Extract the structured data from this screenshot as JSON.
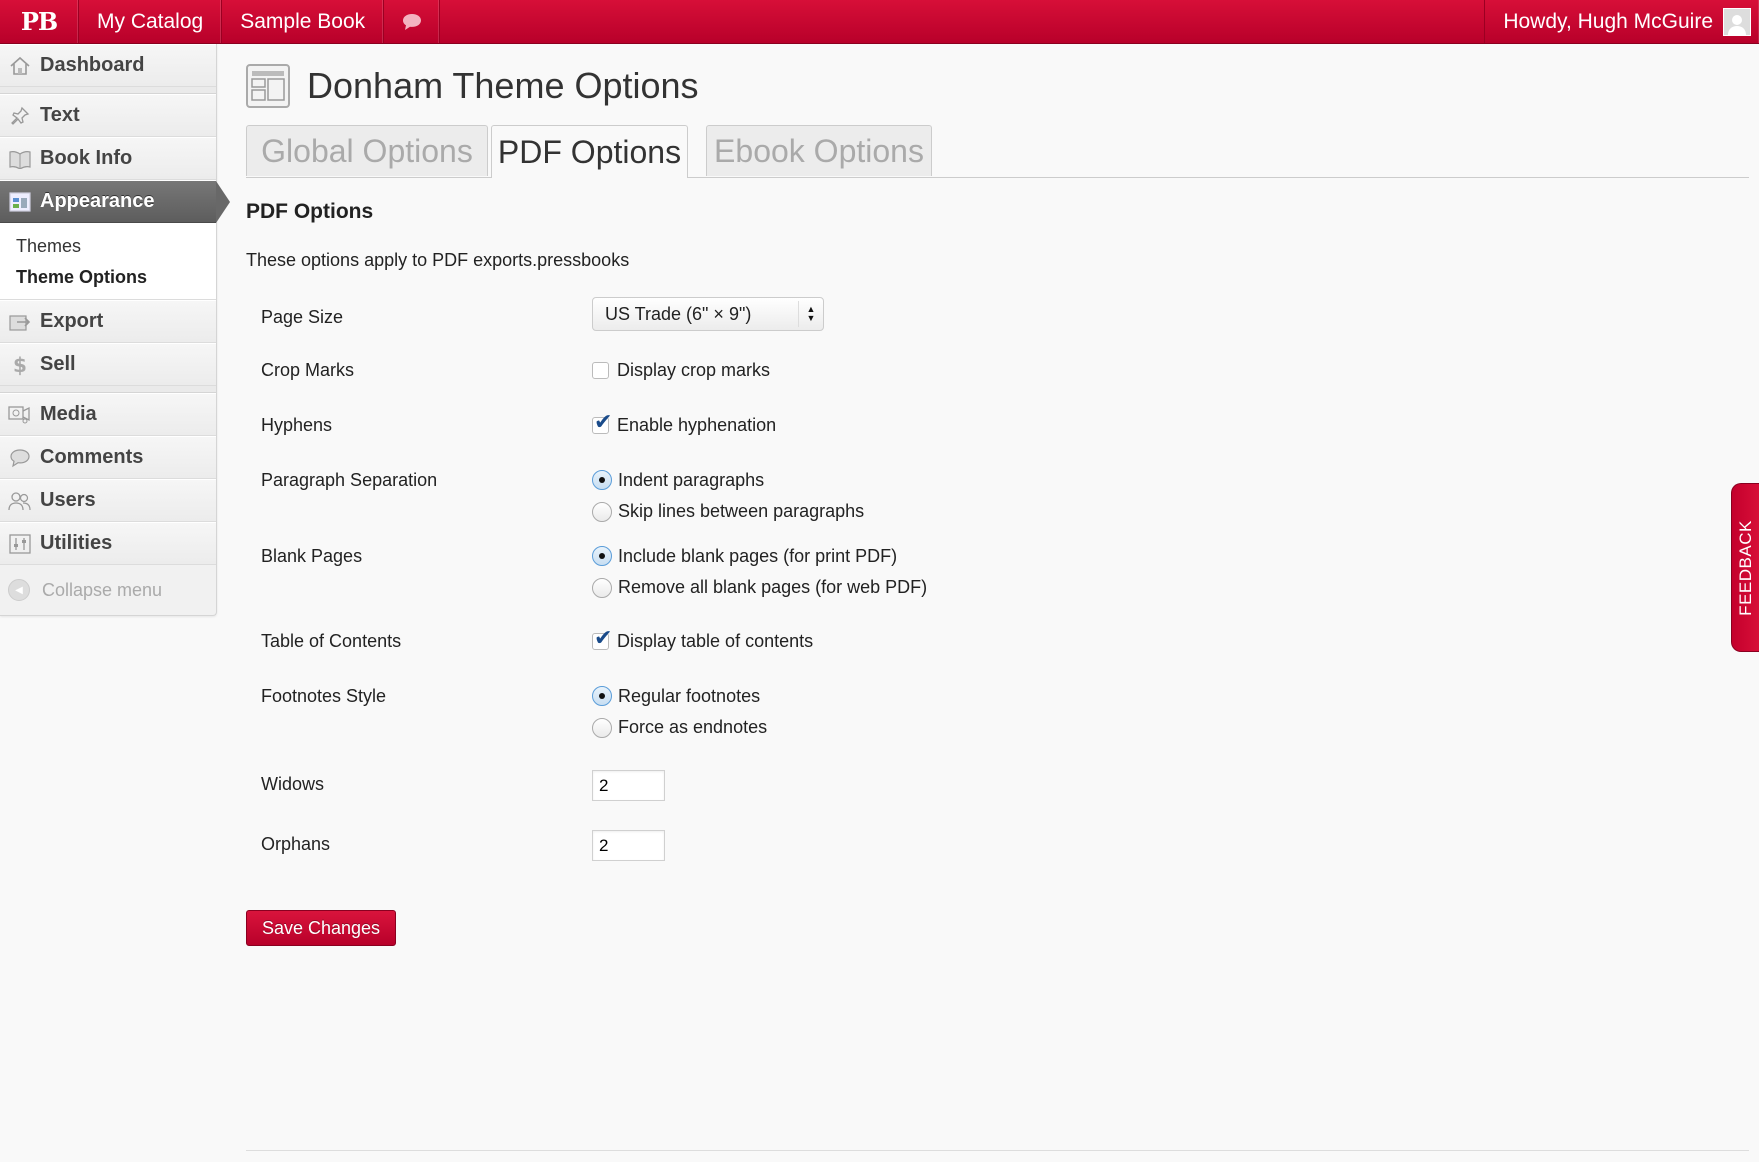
{
  "adminbar": {
    "logo": "PB",
    "my_catalog": "My Catalog",
    "book_title": "Sample Book",
    "comment_icon": "comment-bubble-icon",
    "greeting": "Howdy, Hugh McGuire",
    "accent_color": "#c8002f"
  },
  "sidebar": {
    "items": [
      {
        "label": "Dashboard",
        "icon": "home-icon"
      },
      {
        "label": "Text",
        "icon": "pushpin-icon"
      },
      {
        "label": "Book Info",
        "icon": "book-icon"
      },
      {
        "label": "Appearance",
        "icon": "appearance-icon"
      },
      {
        "label": "Export",
        "icon": "export-icon"
      },
      {
        "label": "Sell",
        "icon": "dollar-icon"
      },
      {
        "label": "Media",
        "icon": "media-icon"
      },
      {
        "label": "Comments",
        "icon": "comments-icon"
      },
      {
        "label": "Users",
        "icon": "users-icon"
      },
      {
        "label": "Utilities",
        "icon": "utilities-icon"
      }
    ],
    "submenu": {
      "themes": "Themes",
      "theme_options": "Theme Options"
    },
    "collapse": "Collapse menu"
  },
  "page": {
    "title": "Donham Theme Options",
    "tabs": [
      "Global Options",
      "PDF Options",
      "Ebook Options"
    ],
    "active_tab": "PDF Options",
    "section_title": "PDF Options",
    "description": "These options apply to PDF exports.pressbooks"
  },
  "form": {
    "page_size": {
      "label": "Page Size",
      "value": "US Trade (6\" × 9\")"
    },
    "crop_marks": {
      "label": "Crop Marks",
      "option": "Display crop marks",
      "checked": false
    },
    "hyphens": {
      "label": "Hyphens",
      "option": "Enable hyphenation",
      "checked": true
    },
    "paragraph_separation": {
      "label": "Paragraph Separation",
      "options": [
        "Indent paragraphs",
        "Skip lines between paragraphs"
      ],
      "selected": 0
    },
    "blank_pages": {
      "label": "Blank Pages",
      "options": [
        "Include blank pages (for print PDF)",
        "Remove all blank pages (for web PDF)"
      ],
      "selected": 0
    },
    "toc": {
      "label": "Table of Contents",
      "option": "Display table of contents",
      "checked": true
    },
    "footnotes": {
      "label": "Footnotes Style",
      "options": [
        "Regular footnotes",
        "Force as endnotes"
      ],
      "selected": 0
    },
    "widows": {
      "label": "Widows",
      "value": "2"
    },
    "orphans": {
      "label": "Orphans",
      "value": "2"
    },
    "save": "Save Changes"
  },
  "feedback": "FEEDBACK"
}
